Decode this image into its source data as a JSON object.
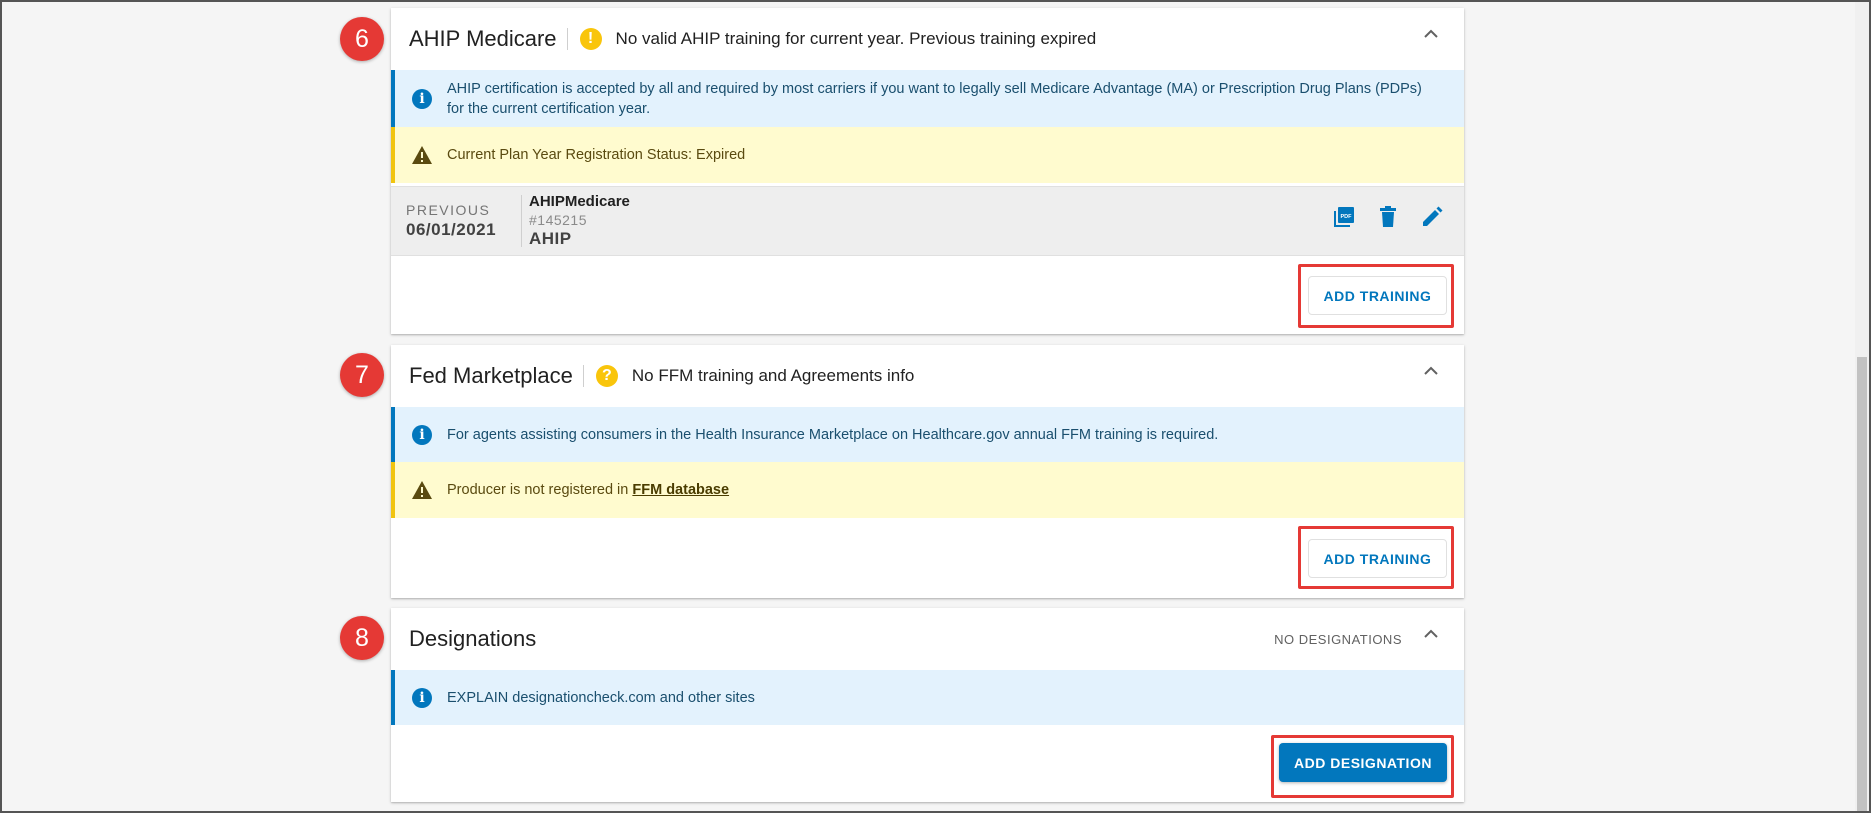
{
  "sections": {
    "ahip": {
      "step_number": "6",
      "title": "AHIP Medicare",
      "status_icon": "warning-circle-icon",
      "status_text": "No valid AHIP training for current year. Previous training expired",
      "info": "AHIP certification is accepted by all and required by most carriers if you want to legally sell Medicare Advantage (MA) or Prescription Drug Plans (PDPs) for the current certification year.",
      "warning": "Current Plan Year Registration Status: Expired",
      "record": {
        "label": "PREVIOUS",
        "date": "06/01/2021",
        "name": "AHIPMedicare",
        "number": "#145215",
        "org": "AHIP"
      },
      "button_label": "ADD TRAINING"
    },
    "ffm": {
      "step_number": "7",
      "title": "Fed Marketplace",
      "status_icon": "question-circle-icon",
      "status_text": "No FFM training and Agreements info",
      "info": "For agents assisting consumers in the Health Insurance Marketplace on Healthcare.gov annual FFM training is required.",
      "warning_prefix": "Producer is not registered in ",
      "warning_link": "FFM database",
      "button_label": "ADD TRAINING"
    },
    "designations": {
      "step_number": "8",
      "title": "Designations",
      "status_text": "NO DESIGNATIONS",
      "info": "EXPLAIN designationcheck.com and other sites",
      "button_label": "ADD DESIGNATION"
    }
  },
  "colors": {
    "accent": "#0277bd",
    "highlight": "#e53935",
    "warning_bg": "#fffbcf",
    "info_bg": "#e3f2fd",
    "status_yellow": "#f9c50b"
  }
}
